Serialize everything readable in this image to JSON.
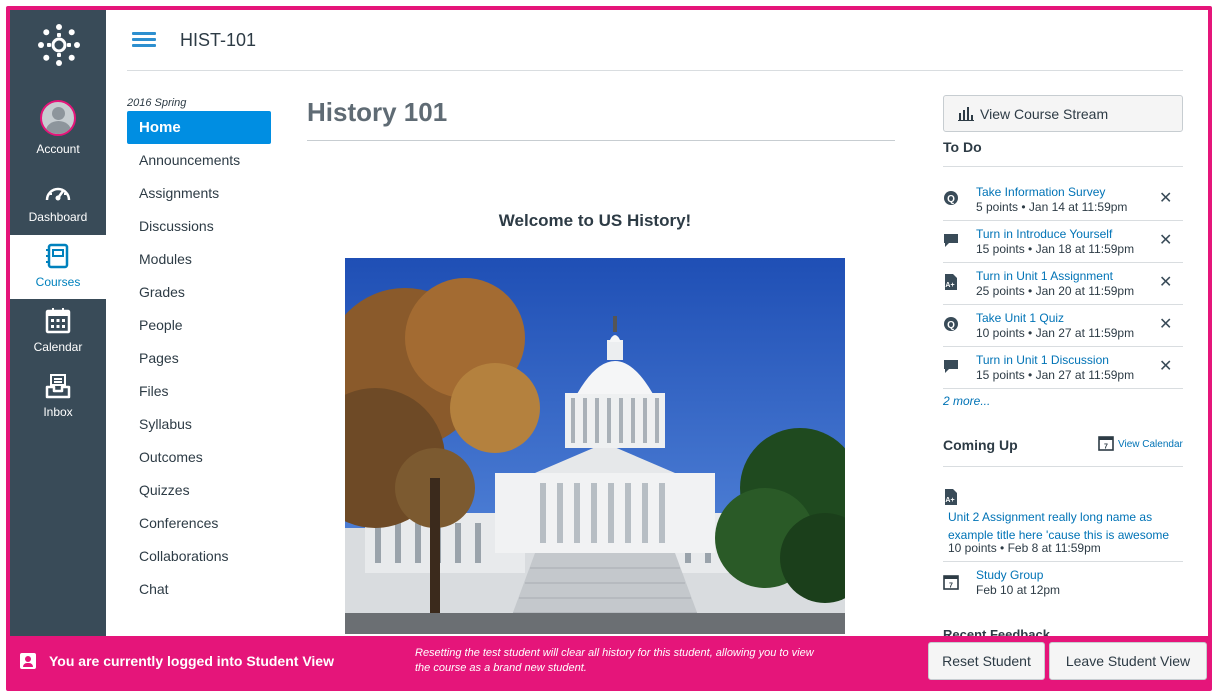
{
  "global_nav": {
    "items": [
      {
        "key": "account",
        "label": "Account",
        "icon": "avatar"
      },
      {
        "key": "dashboard",
        "label": "Dashboard",
        "icon": "dashboard-icon"
      },
      {
        "key": "courses",
        "label": "Courses",
        "icon": "courses-icon",
        "active": true
      },
      {
        "key": "calendar",
        "label": "Calendar",
        "icon": "calendar-icon"
      },
      {
        "key": "inbox",
        "label": "Inbox",
        "icon": "inbox-icon"
      }
    ]
  },
  "header": {
    "course_code": "HIST-101"
  },
  "course_nav": {
    "term": "2016 Spring",
    "items": [
      "Home",
      "Announcements",
      "Assignments",
      "Discussions",
      "Modules",
      "Grades",
      "People",
      "Pages",
      "Files",
      "Syllabus",
      "Outcomes",
      "Quizzes",
      "Conferences",
      "Collaborations",
      "Chat"
    ]
  },
  "main": {
    "title": "History 101",
    "welcome": "Welcome to US History!"
  },
  "sidebar": {
    "stream_button": "View Course Stream",
    "todo_heading": "To Do",
    "todo": [
      {
        "icon": "quiz-icon",
        "title": "Take Information Survey",
        "meta": "5 points • Jan 14 at 11:59pm"
      },
      {
        "icon": "discussion-icon",
        "title": "Turn in Introduce Yourself",
        "meta": "15 points • Jan 18 at 11:59pm"
      },
      {
        "icon": "assignment-icon",
        "title": "Turn in Unit 1 Assignment",
        "meta": "25 points • Jan 20 at 11:59pm"
      },
      {
        "icon": "quiz-icon",
        "title": "Take Unit 1 Quiz",
        "meta": "10 points • Jan 27 at 11:59pm"
      },
      {
        "icon": "discussion-icon",
        "title": "Turn in Unit 1 Discussion",
        "meta": "15 points • Jan 27 at 11:59pm"
      }
    ],
    "more": "2 more...",
    "coming_heading": "Coming Up",
    "view_calendar": "View Calendar",
    "coming": [
      {
        "title": "Unit 2 Assignment really long name as example title here 'cause this is awesome",
        "meta": "10 points • Feb 8 at 11:59pm"
      },
      {
        "title": "Study Group",
        "meta": "Feb 10 at 12pm"
      }
    ],
    "recent_heading": "Recent Feedback"
  },
  "student_view": {
    "message": "You are currently logged into Student View",
    "note": "Resetting the test student will clear all history for this student, allowing you to view the course as a brand new student.",
    "reset_label": "Reset Student",
    "leave_label": "Leave Student View"
  },
  "colors": {
    "nav_bg": "#394b58",
    "accent": "#008ee2",
    "link": "#0073b6",
    "student_view": "#e5157a"
  }
}
